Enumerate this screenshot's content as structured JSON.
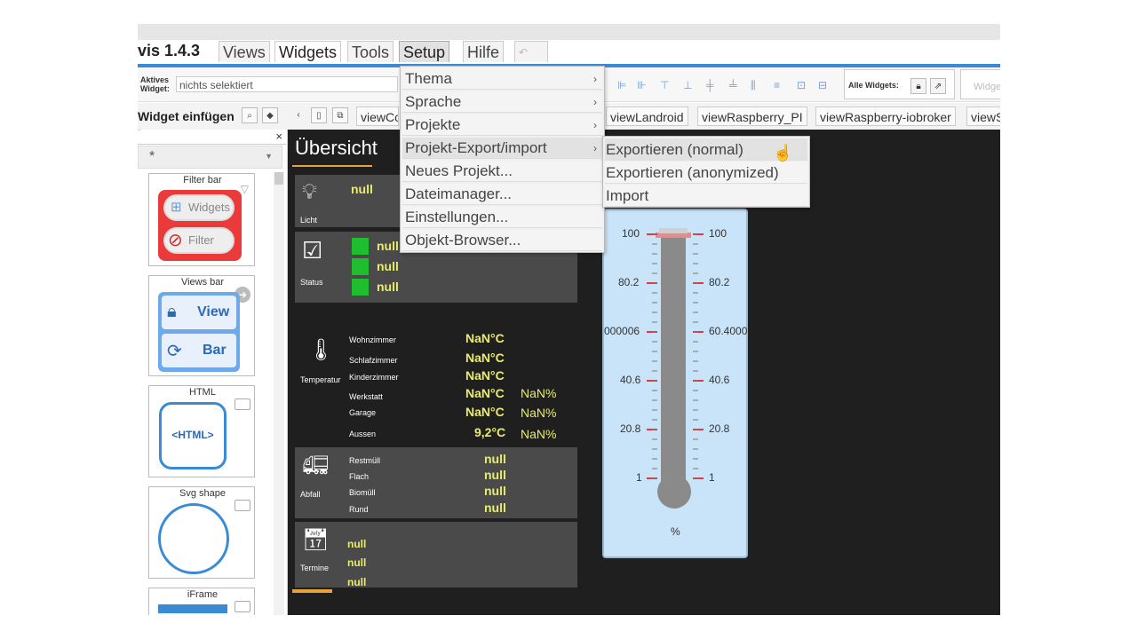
{
  "menubar": {
    "brand": "vis 1.4.3",
    "tabs": [
      "Views",
      "Widgets",
      "Tools",
      "Setup",
      "Hilfe"
    ],
    "undo_icon": "undo-icon"
  },
  "toolbar": {
    "active_label_1": "Aktives",
    "active_label_2": "Widget:",
    "active_value": "nichts selektiert",
    "alle_widgets": "Alle Widgets:",
    "widge_btn": "Widge"
  },
  "row3": {
    "insert_label": "Widget einfügen",
    "view_tabs": [
      "viewCo",
      "viewLandroid",
      "viewRaspberry_PI",
      "viewRaspberry-iobroker",
      "viewS"
    ]
  },
  "palette": {
    "close": "×",
    "filter_mark": "*",
    "select_value": "*",
    "cards": [
      {
        "title": "Filter bar",
        "btn1": "Widgets",
        "btn2": "Filter"
      },
      {
        "title": "Views bar",
        "btn1": "View",
        "btn2": "Bar"
      },
      {
        "title": "HTML",
        "content": "<HTML>"
      },
      {
        "title": "Svg shape"
      },
      {
        "title": "iFrame"
      }
    ]
  },
  "canvas": {
    "title": "Übersicht",
    "licht": {
      "label": "Licht",
      "value": "null"
    },
    "status": {
      "label": "Status",
      "values": [
        "null",
        "null",
        "null"
      ]
    },
    "temperatur": {
      "label": "Temperatur",
      "rows": [
        {
          "name": "Wohnzimmer",
          "temp": "NaN°C",
          "hum": ""
        },
        {
          "name": "Schlafzimmer",
          "temp": "NaN°C",
          "hum": ""
        },
        {
          "name": "Kinderzimmer",
          "temp": "NaN°C",
          "hum": ""
        },
        {
          "name": "Werkstatt",
          "temp": "NaN°C",
          "hum": "NaN%"
        },
        {
          "name": "Garage",
          "temp": "NaN°C",
          "hum": "NaN%"
        },
        {
          "name": "Aussen",
          "temp": "9,2°C",
          "hum": "NaN%"
        }
      ]
    },
    "abfall": {
      "label": "Abfall",
      "rows": [
        {
          "name": "Restmüll",
          "value": "null"
        },
        {
          "name": "Flach",
          "value": "null"
        },
        {
          "name": "Biomüll",
          "value": "null"
        },
        {
          "name": "Rund",
          "value": "null"
        }
      ]
    },
    "termine": {
      "label": "Termine",
      "values": [
        "null",
        "null",
        "null"
      ]
    }
  },
  "thermometer": {
    "left_ticks": [
      "100",
      "80.2",
      "000006",
      "40.6",
      "20.8",
      "1"
    ],
    "right_ticks": [
      "100",
      "80.2",
      "60.4000",
      "40.6",
      "20.8",
      "1"
    ],
    "unit": "%"
  },
  "dropdown": {
    "items": [
      {
        "label": "Thema",
        "arrow": "›"
      },
      {
        "label": "Sprache",
        "arrow": "›"
      },
      {
        "label": "Projekte",
        "arrow": "›"
      },
      {
        "label": "Projekt-Export/import",
        "arrow": "›"
      },
      {
        "label": "Neues Projekt...",
        "arrow": ""
      },
      {
        "label": "Dateimanager...",
        "arrow": ""
      },
      {
        "label": "Einstellungen...",
        "arrow": ""
      },
      {
        "label": "Objekt-Browser...",
        "arrow": ""
      }
    ],
    "submenu": [
      "Exportieren (normal)",
      "Exportieren (anonymized)",
      "Import"
    ]
  },
  "colors": {
    "accent_blue": "#3a8ad6",
    "canvas_bg": "#1f1f1f",
    "panel_bg": "#4a4a4a",
    "value_yellow": "#e9ec6b",
    "status_green": "#1fbe2f",
    "title_orange": "#e8a23c",
    "thermo_bg": "#c9e4f9"
  }
}
